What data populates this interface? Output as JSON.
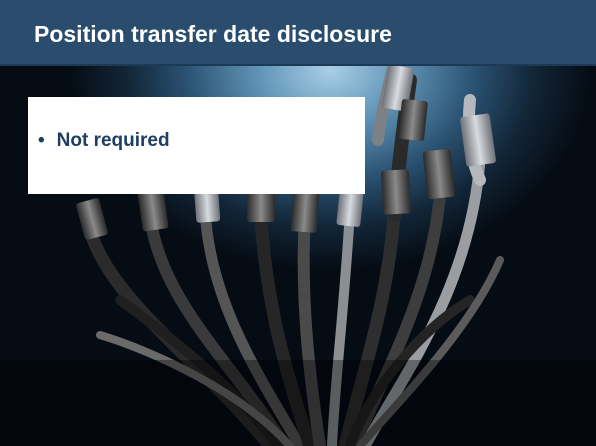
{
  "slide": {
    "title": "Position transfer date disclosure",
    "bullets": [
      {
        "marker": "•",
        "text": "Not required"
      }
    ]
  },
  "colors": {
    "title_bar": "#2a4d6e",
    "title_text": "#ffffff",
    "bullet_text": "#1f3f62",
    "content_box": "#ffffff",
    "background_glow": "#a9cfe6",
    "background_dark": "#060c14"
  },
  "background_image": "network-cables-bundle"
}
